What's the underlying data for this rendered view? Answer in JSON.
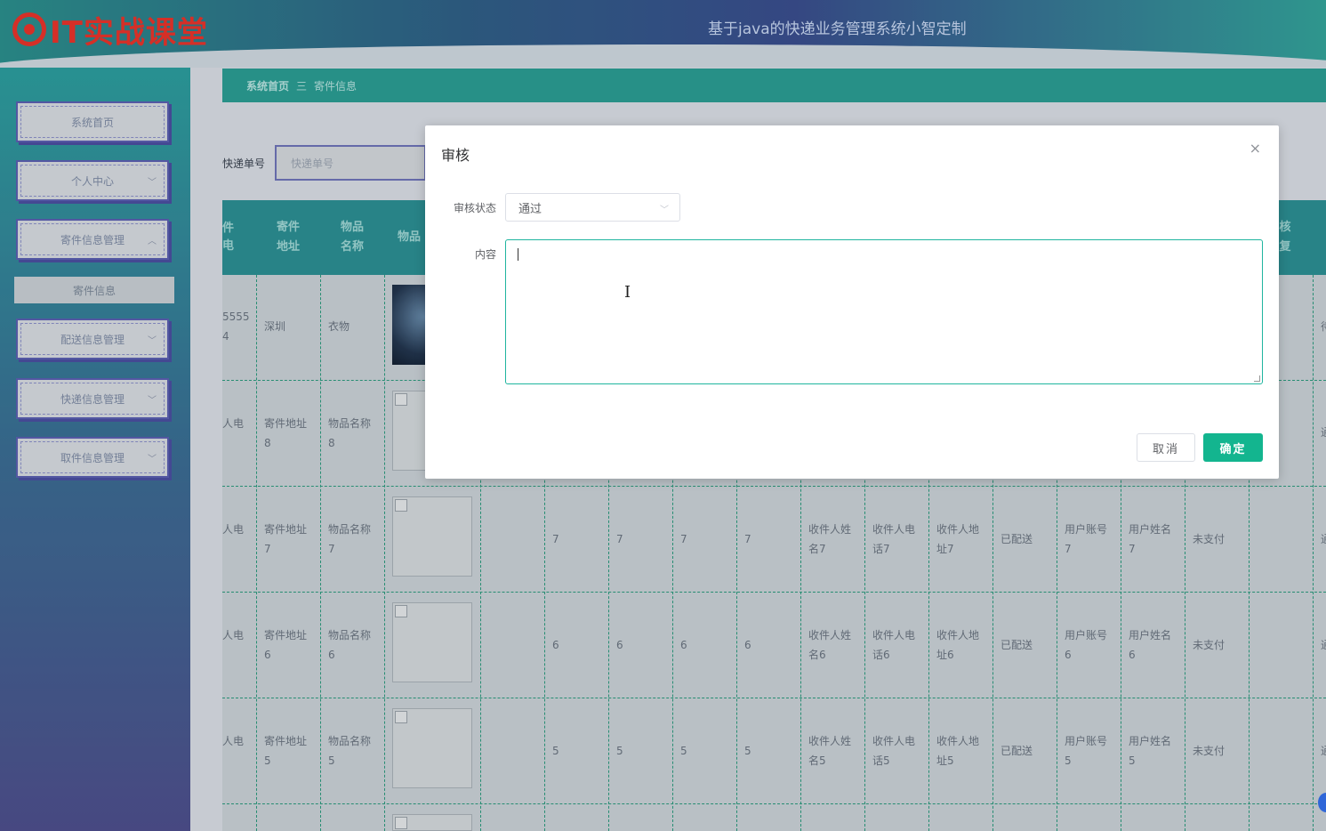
{
  "header": {
    "logo_text": "IT实战课堂",
    "system_title": "基于java的快递业务管理系统小智定制"
  },
  "sidebar": {
    "items": [
      {
        "label": "系统首页",
        "chevron": ""
      },
      {
        "label": "个人中心",
        "chevron": "﹀"
      },
      {
        "label": "寄件信息管理",
        "chevron": "︿"
      },
      {
        "label": "配送信息管理",
        "chevron": "﹀"
      },
      {
        "label": "快递信息管理",
        "chevron": "﹀"
      },
      {
        "label": "取件信息管理",
        "chevron": "﹀"
      }
    ],
    "submenu_label": "寄件信息"
  },
  "breadcrumb": {
    "home": "系统首页",
    "separator": "三",
    "current": "寄件信息"
  },
  "search": {
    "label": "快递单号",
    "placeholder": "快递单号"
  },
  "table": {
    "headers": {
      "col0": "件\n电",
      "col1": "寄件\n地址",
      "col2": "物品\n名称",
      "col3": "物品",
      "col_right": "核\n复"
    },
    "rows": [
      {
        "c0": "5555\n4",
        "c1": "深圳",
        "c2": "衣物",
        "nums": [
          "",
          "",
          "",
          ""
        ],
        "n1": "",
        "n2": "",
        "n3": "",
        "status": "",
        "acc": "",
        "uname": "",
        "pay": "",
        "tail": "待"
      },
      {
        "c0": "人电",
        "c1": "寄件地址\n8",
        "c2": "物品名称\n8",
        "nums": [
          "",
          "",
          "",
          ""
        ],
        "n1": "",
        "n2": "",
        "n3": "",
        "status": "",
        "acc": "",
        "uname": "",
        "pay": "",
        "tail": "通"
      },
      {
        "c0": "人电",
        "c1": "寄件地址\n7",
        "c2": "物品名称\n7",
        "nums": [
          "7",
          "7",
          "7",
          "7"
        ],
        "n1": "收件人姓\n名7",
        "n2": "收件人电\n话7",
        "n3": "收件人地\n址7",
        "status": "已配送",
        "acc": "用户账号\n7",
        "uname": "用户姓名\n7",
        "pay": "未支付",
        "tail": "通"
      },
      {
        "c0": "人电",
        "c1": "寄件地址\n6",
        "c2": "物品名称\n6",
        "nums": [
          "6",
          "6",
          "6",
          "6"
        ],
        "n1": "收件人姓\n名6",
        "n2": "收件人电\n话6",
        "n3": "收件人地\n址6",
        "status": "已配送",
        "acc": "用户账号\n6",
        "uname": "用户姓名\n6",
        "pay": "未支付",
        "tail": "通"
      },
      {
        "c0": "人电",
        "c1": "寄件地址\n5",
        "c2": "物品名称\n5",
        "nums": [
          "5",
          "5",
          "5",
          "5"
        ],
        "n1": "收件人姓\n名5",
        "n2": "收件人电\n话5",
        "n3": "收件人地\n址5",
        "status": "已配送",
        "acc": "用户账号\n5",
        "uname": "用户姓名\n5",
        "pay": "未支付",
        "tail": "通"
      }
    ]
  },
  "modal": {
    "title": "审核",
    "close_icon": "×",
    "status_label": "审核状态",
    "status_value": "通过",
    "content_label": "内容",
    "content_value": "",
    "cancel_label": "取消",
    "ok_label": "确定"
  },
  "colors": {
    "accent": "#13b58f",
    "header_teal": "#2b9d93",
    "logo_red": "#e8332b"
  }
}
